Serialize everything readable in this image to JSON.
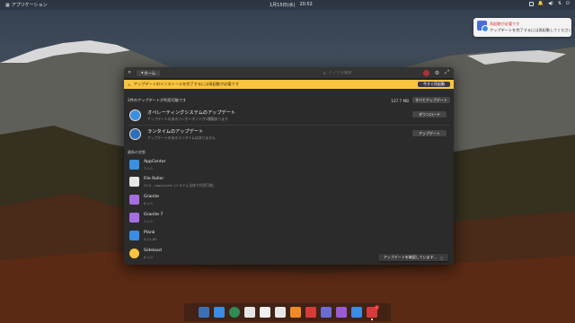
{
  "top_panel": {
    "applications_label": "アプリケーション",
    "date": "1月15日(水)",
    "time": "20:52"
  },
  "notification": {
    "title": "再起動が必要です",
    "body": "アップデートを完了するには再起動してください"
  },
  "header": {
    "back_label": "ホーム",
    "search_placeholder": "アプリを検索"
  },
  "banner": {
    "text": "アップデートのインストールを完了するには再起動が必要です",
    "button": "今すぐ再起動"
  },
  "updates_section": {
    "title": "2件のアップデートが利用可能です",
    "size": "137.7 MB",
    "update_all_button": "すべてアップデート",
    "items": [
      {
        "name": "オペレーティングシステムのアップデート",
        "desc": "アップデートのあるコンポーネントが2種類あります",
        "button": "ダウンロード",
        "icon": "os-update-icon"
      },
      {
        "name": "ランタイムのアップデート",
        "desc": "アップデートのあるランタイムはありません",
        "button": "アップデート",
        "icon": "runtime-update-icon"
      }
    ]
  },
  "recent_section": {
    "title": "最新の状態",
    "apps": [
      {
        "name": "AppCenter",
        "version": "7.1.0",
        "color": "#3c8fe0",
        "icon": "appcenter-icon"
      },
      {
        "name": "File Roller",
        "version": "43.0 - AppCenter (システム全体で利用可能)",
        "color": "#e6e6e6",
        "icon": "file-roller-icon"
      },
      {
        "name": "Granite",
        "version": "6.2.0",
        "color": "#a56de2",
        "icon": "granite-icon"
      },
      {
        "name": "Granite 7",
        "version": "7.1.0",
        "color": "#a56de2",
        "icon": "granite-7-icon"
      },
      {
        "name": "Plank",
        "version": "0.11.89",
        "color": "#3a8de6",
        "icon": "plank-icon"
      },
      {
        "name": "Sideload",
        "version": "6.1.0",
        "color": "#f9c440",
        "icon": "sideload-icon"
      }
    ]
  },
  "check_toast": {
    "label": "アップデートを確認しています…"
  },
  "dock": {
    "items": [
      {
        "icon": "multitasking-icon",
        "color": "#3b6fb6"
      },
      {
        "icon": "files-icon",
        "color": "#3a8de6"
      },
      {
        "icon": "web-browser-icon",
        "color": "#2e8b57"
      },
      {
        "icon": "mail-icon",
        "color": "#e6e6e6"
      },
      {
        "icon": "tasks-icon",
        "color": "#f0f0f0"
      },
      {
        "icon": "calendar-icon",
        "color": "#e8e8e8"
      },
      {
        "icon": "music-icon",
        "color": "#f08a24"
      },
      {
        "icon": "videos-icon",
        "color": "#d93a3a"
      },
      {
        "icon": "photos-icon",
        "color": "#6b6bd6"
      },
      {
        "icon": "camera-icon",
        "color": "#9a5ad6"
      },
      {
        "icon": "settings-icon",
        "color": "#3a8de6"
      },
      {
        "icon": "appcenter-dock-icon",
        "color": "#d93a3a",
        "badge": "1"
      }
    ]
  }
}
